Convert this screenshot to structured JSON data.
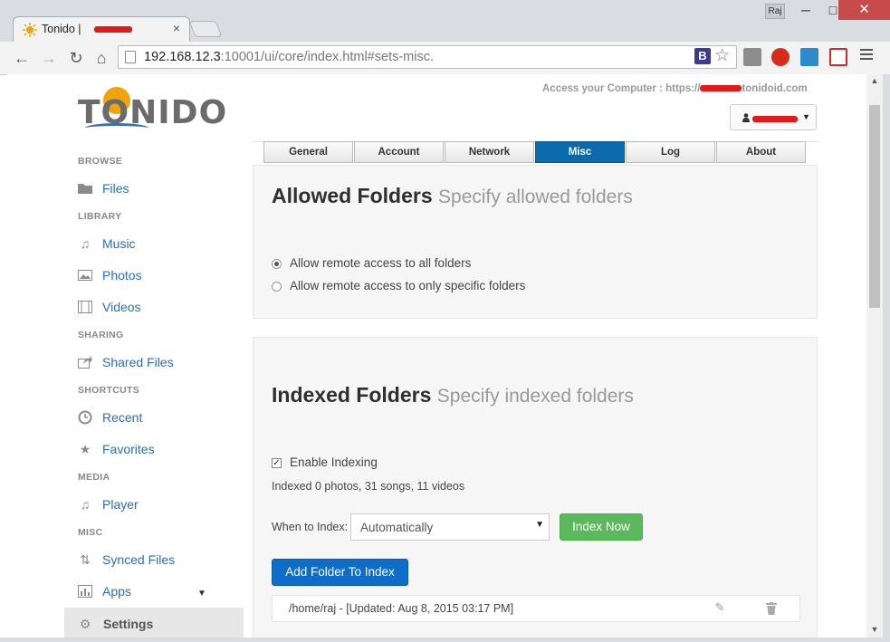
{
  "browser": {
    "tab_title": "Tonido |",
    "tab_close": "×",
    "profile_name": "Raj",
    "window_controls": {
      "minimize": "─",
      "maximize": "□",
      "close": "✕"
    },
    "url_host": "192.168.12.3",
    "url_rest": ":10001/ui/core/index.html#sets-misc.",
    "ext_b": "B"
  },
  "header": {
    "logo_text": "TONIDO",
    "access_prefix": "Access your Computer : https://",
    "access_suffix": "tonidoid.com"
  },
  "sidebar": {
    "sections": [
      {
        "heading": "BROWSE",
        "items": [
          {
            "label": "Files",
            "icon": "folder-icon"
          }
        ]
      },
      {
        "heading": "LIBRARY",
        "items": [
          {
            "label": "Music",
            "icon": "music-icon"
          },
          {
            "label": "Photos",
            "icon": "photo-icon"
          },
          {
            "label": "Videos",
            "icon": "film-icon"
          }
        ]
      },
      {
        "heading": "SHARING",
        "items": [
          {
            "label": "Shared Files",
            "icon": "share-icon"
          }
        ]
      },
      {
        "heading": "SHORTCUTS",
        "items": [
          {
            "label": "Recent",
            "icon": "clock-icon"
          },
          {
            "label": "Favorites",
            "icon": "star-icon"
          }
        ]
      },
      {
        "heading": "MEDIA",
        "items": [
          {
            "label": "Player",
            "icon": "music-icon"
          }
        ]
      },
      {
        "heading": "MISC",
        "items": [
          {
            "label": "Synced Files",
            "icon": "sync-icon"
          },
          {
            "label": "Apps",
            "icon": "chart-icon"
          }
        ]
      }
    ],
    "settings_label": "Settings"
  },
  "tabs": [
    "General",
    "Account",
    "Network",
    "Misc",
    "Log",
    "About"
  ],
  "active_tab": "Misc",
  "allowed": {
    "title": "Allowed Folders",
    "subtitle": "Specify allowed folders",
    "options": [
      "Allow remote access to all folders",
      "Allow remote access to only specific folders"
    ],
    "selected": 0
  },
  "indexed": {
    "title": "Indexed Folders",
    "subtitle": "Specify indexed folders",
    "enable_label": "Enable Indexing",
    "enabled": true,
    "stats": "Indexed 0 photos, 31 songs, 11 videos",
    "when_label": "When to Index:",
    "when_value": "Automatically",
    "index_now": "Index Now",
    "add_folder": "Add Folder To Index",
    "folders": [
      "/home/raj - [Updated: Aug 8, 2015 03:17 PM]"
    ]
  },
  "colors": {
    "accent": "#0b6aab",
    "link": "#2a6ebb",
    "green": "#5cb85c",
    "blue_button": "#0e6dc9"
  }
}
